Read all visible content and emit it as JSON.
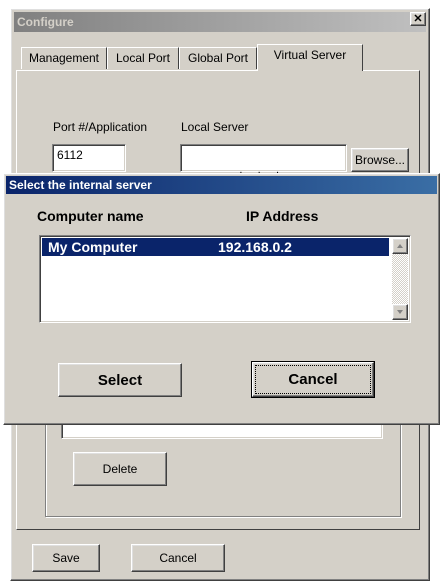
{
  "configure": {
    "title": "Configure",
    "close_glyph": "✕",
    "tabs": [
      {
        "label": "Management"
      },
      {
        "label": "Local Port"
      },
      {
        "label": "Global Port"
      },
      {
        "label": "Virtual Server"
      }
    ],
    "port_label": "Port #/Application",
    "port_value": "6112",
    "server_label": "Local Server",
    "ip_value": ".     .     .",
    "browse_label": "Browse...",
    "delete_label": "Delete",
    "save_label": "Save",
    "cancel_label": "Cancel"
  },
  "dialog": {
    "title": "Select the internal server",
    "col_computer": "Computer name",
    "col_ip": "IP Address",
    "rows": [
      {
        "computer": "My Computer",
        "ip": "192.168.0.2",
        "selected": true
      }
    ],
    "select_label": "Select",
    "cancel_label": "Cancel"
  },
  "icons": {
    "scroll_up": "arrow-up-icon",
    "scroll_down": "arrow-down-icon",
    "close": "close-icon"
  },
  "colors": {
    "face": "#d4d0c8",
    "active_title": "#0a246a",
    "inactive_title": "#808080",
    "selection": "#0a246a"
  }
}
